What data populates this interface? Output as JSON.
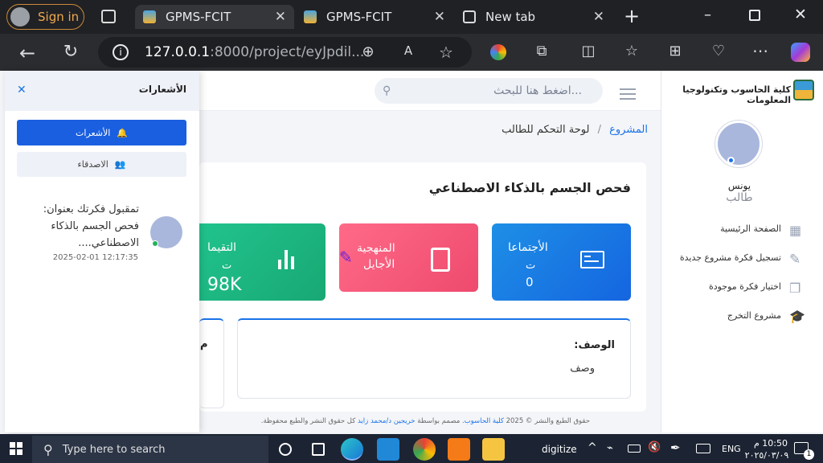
{
  "browser": {
    "profile_label": "Sign in",
    "tabs": [
      {
        "title": "GPMS-FCIT",
        "active": true
      },
      {
        "title": "GPMS-FCIT",
        "active": false
      },
      {
        "title": "New tab",
        "active": false
      }
    ],
    "url_host": "127.0.0.1",
    "url_rest": ":8000/project/eyJpdil..."
  },
  "site": {
    "name": "كلية الحاسوب وتكنولوجيا المعلومات",
    "search_placeholder": "اضغط هنا للبحث...",
    "breadcrumb_home": "المشروع",
    "breadcrumb_sep": "/",
    "breadcrumb_current": "لوحة التحكم للطالب"
  },
  "user": {
    "name": "يونس",
    "role": "طالب"
  },
  "nav": [
    {
      "label": "الصفحة الرئيسية",
      "icon": "grid-icon"
    },
    {
      "label": "تسجيل فكرة مشروع جديدة",
      "icon": "edit-icon"
    },
    {
      "label": "اختيار فكرة موجودة",
      "icon": "copy-icon"
    },
    {
      "label": "مشروع التخرج",
      "icon": "graduate-icon"
    }
  ],
  "project": {
    "title": "فحص الجسم بالذكاء الاصطناعي",
    "stats": [
      {
        "label": "الأجتماعا",
        "sub": "ت",
        "value": "0",
        "color": "#1e88e5",
        "icon": "meeting-icon"
      },
      {
        "label": "المنهجية",
        "sub": "الأجايل",
        "value": "",
        "color": "#f0527a",
        "icon": "book-icon"
      },
      {
        "label": "التقيما",
        "sub": "ت",
        "value": "98K",
        "color": "#1fbf8a",
        "icon": "chart-icon"
      }
    ],
    "description_label": "الوصف:",
    "description_value": "وصف",
    "partial_label": "م"
  },
  "notifications": {
    "title": "الأشعارات",
    "tab_notifications": "الأشعرات",
    "tab_friends": "الاصدقاء",
    "item_line1": "تمقبول فكرتك بعنوان:",
    "item_line2": "فحص الجسم بالذكاء",
    "item_line3": "الاصطناعي....",
    "item_time": "2025-02-01 12:17:35"
  },
  "footer": {
    "text_before": "حقوق الطبع والنشر © 2025",
    "college_link": "كلية الحاسوب",
    "text_mid": ". مصمم بواسطة",
    "author_link": "خريجين د/محمد زايد",
    "text_after": "كل حقوق النشر والطبع محفوظة."
  },
  "taskbar": {
    "search_placeholder": "Type here to search",
    "digitize_label": "digitize",
    "lang": "ENG",
    "time": "10:50 م",
    "date": "٢٠٢٥/٠٣/٠٩",
    "notif_count": "1"
  },
  "colors": {
    "primary": "#1a73e8",
    "meeting": "#1e88e5",
    "methodology": "#f0527a",
    "ratings": "#1fbf8a"
  }
}
